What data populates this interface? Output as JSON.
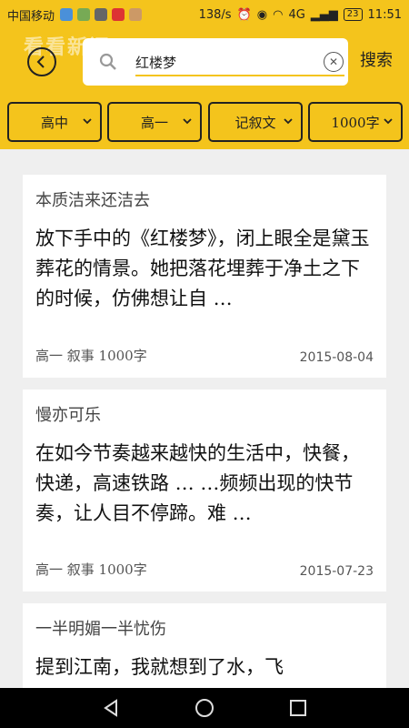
{
  "status": {
    "carrier": "中国移动",
    "speed": "138/s",
    "network": "4G",
    "battery": "23",
    "time": "11:51"
  },
  "header": {
    "logo": "看看新闻",
    "search_value": "红楼梦",
    "search_button": "搜索"
  },
  "filters": [
    {
      "label": "高中"
    },
    {
      "label": "高一"
    },
    {
      "label": "记叙文"
    },
    {
      "label": "1000字"
    }
  ],
  "articles": [
    {
      "title": "本质洁来还洁去",
      "excerpt": "放下手中的《红楼梦》，闭上眼全是黛玉葬花的情景。她把落花埋葬于净土之下的时候，仿佛想让自 …",
      "meta": "高一 叙事 1000字",
      "date": "2015-08-04"
    },
    {
      "title": "慢亦可乐",
      "excerpt": "在如今节奏越来越快的生活中，快餐，快递，高速铁路 … …频频出现的快节奏，让人目不停蹄。难 …",
      "meta": "高一 叙事 1000字",
      "date": "2015-07-23"
    },
    {
      "title": "一半明媚一半忧伤",
      "excerpt": "提到江南，我就想到了水，飞",
      "meta": "",
      "date": ""
    }
  ],
  "colors": {
    "accent": "#f4c41c",
    "background": "#efefef"
  }
}
